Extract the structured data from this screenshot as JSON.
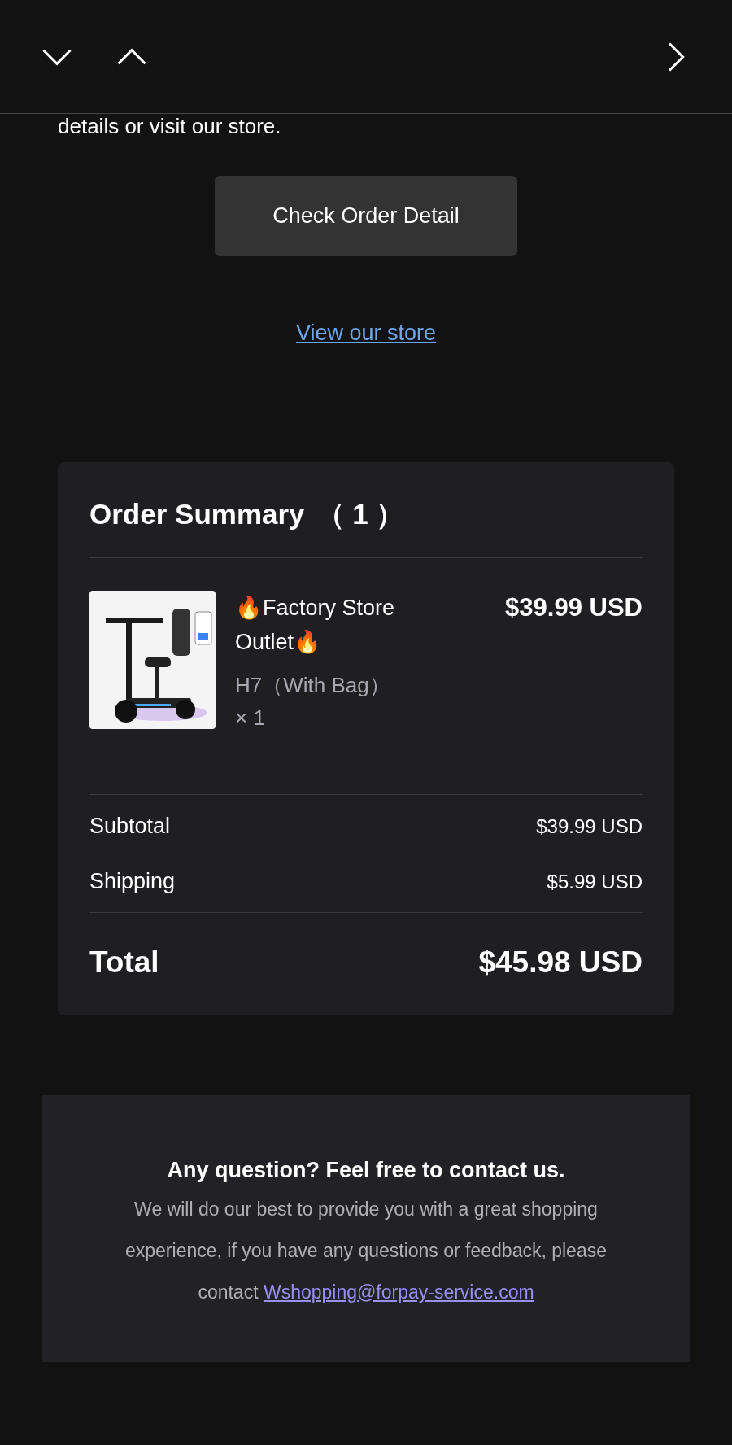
{
  "toolbar": {
    "buttons": [
      {
        "kind": "down"
      },
      {
        "kind": "up"
      },
      {
        "kind": "next"
      }
    ]
  },
  "intro": {
    "text": "details or visit our store."
  },
  "check_button": {
    "label": "Check Order Detail"
  },
  "store_link": {
    "label": "View our store"
  },
  "order_summary": {
    "title": "Order Summary",
    "count": "（ 1 ）",
    "items": [
      {
        "name": "🔥Factory Store Outlet🔥",
        "variant": "H7（With Bag）",
        "quantity": "× 1",
        "price": "$39.99 USD"
      }
    ],
    "lines": [
      {
        "label": "Subtotal",
        "value": "$39.99 USD"
      },
      {
        "label": "Shipping",
        "value": "$5.99 USD"
      }
    ],
    "total": {
      "label": "Total",
      "value": "$45.98 USD"
    }
  },
  "contact": {
    "heading": "Any question? Feel free to contact us.",
    "text": "We will do our best to provide you with a great shopping experience, if you have any questions or feedback, please contact",
    "email": "Wshopping@forpay-service.com"
  }
}
